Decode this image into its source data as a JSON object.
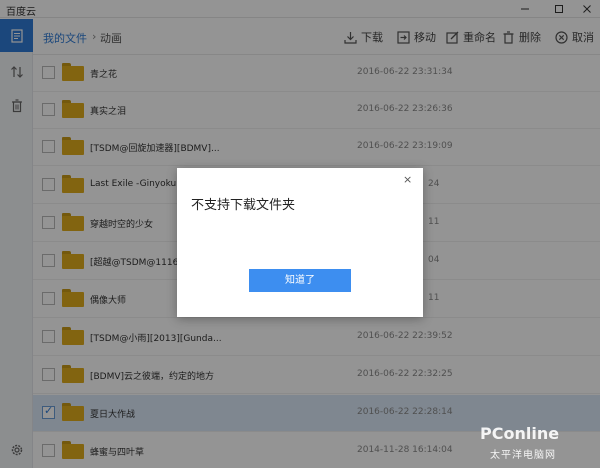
{
  "window": {
    "title": "百度云",
    "min_glyph": "—",
    "max_glyph": "☐",
    "close_glyph": "✕"
  },
  "sidebar": {
    "items": [
      {
        "icon": "file-list-icon",
        "active": true
      },
      {
        "icon": "transfer-icon",
        "active": false
      },
      {
        "icon": "trash-icon",
        "active": false
      },
      {
        "icon": "gear-icon",
        "active": false
      }
    ]
  },
  "breadcrumb": {
    "root": "我的文件",
    "separator": "›",
    "current": "动画"
  },
  "toolbar": {
    "download": "下载",
    "move": "移动",
    "rename": "重命名",
    "delete": "删除",
    "cancel": "取消"
  },
  "files": [
    {
      "name": "青之花",
      "date": "2016-06-22 23:31:34",
      "checked": false
    },
    {
      "name": "真实之泪",
      "date": "2016-06-22 23:26:36",
      "checked": false
    },
    {
      "name": "[TSDM@回旋加速器][BDMV]...",
      "date": "2016-06-22 23:19:09",
      "checked": false
    },
    {
      "name": "Last Exile -Ginyoku no F",
      "date": "",
      "checked": false
    },
    {
      "name": "穿越时空的少女",
      "date": "",
      "checked": false
    },
    {
      "name": "[超越@TSDM@1116231",
      "date": "",
      "checked": false
    },
    {
      "name": "偶像大师",
      "date": "",
      "checked": false
    },
    {
      "name": "[TSDM@小雨][2013][Gunda...",
      "date": "2016-06-22 22:39:52",
      "checked": false
    },
    {
      "name": "[BDMV]云之彼端，约定的地方",
      "date": "2016-06-22 22:32:25",
      "checked": false
    },
    {
      "name": "夏日大作战",
      "date": "2016-06-22 22:28:14",
      "checked": true
    },
    {
      "name": "蜂蜜与四叶草",
      "date": "2014-11-28 16:14:04",
      "checked": false
    }
  ],
  "partial_dates": [
    "24",
    "11",
    "04",
    "11"
  ],
  "dialog": {
    "message": "不支持下载文件夹",
    "close": "×",
    "confirm": "知道了"
  },
  "watermark": {
    "brand": "PConline",
    "sub": "太平洋电脑网"
  },
  "colors": {
    "accent": "#2f7bd6",
    "button": "#3d8ef0",
    "folder": "#e1ac1c",
    "selected_row": "#dbe9f9"
  }
}
